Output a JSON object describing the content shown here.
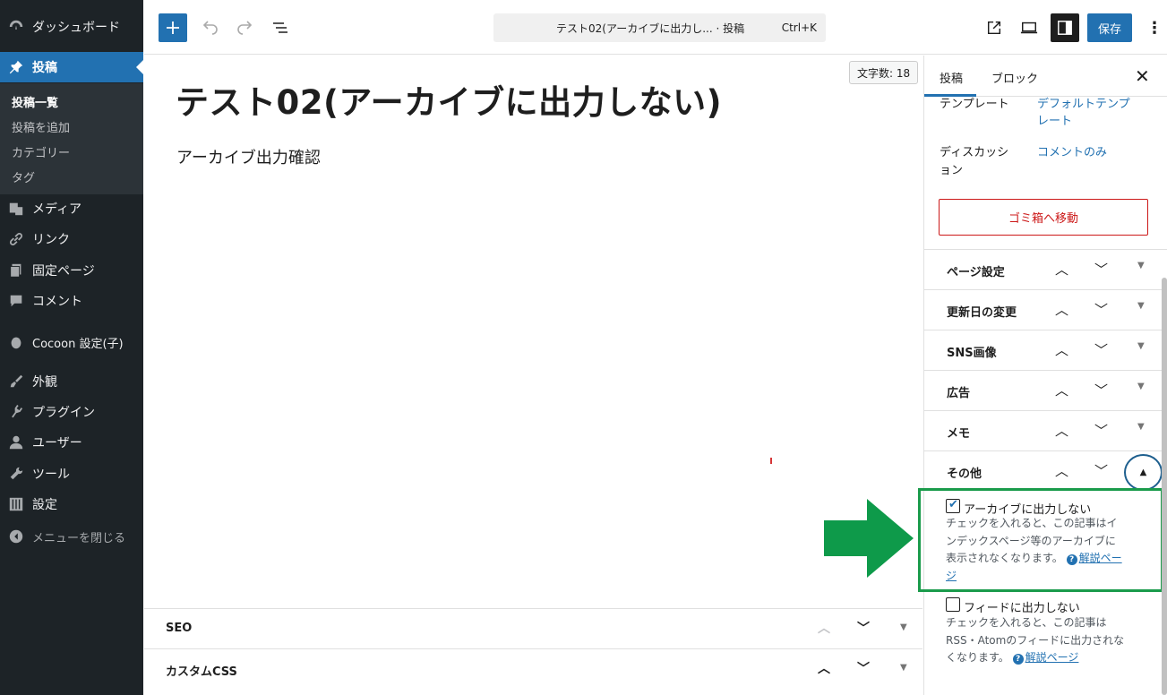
{
  "admin_menu": {
    "dashboard": "ダッシュボード",
    "posts": "投稿",
    "posts_sub": [
      "投稿一覧",
      "投稿を追加",
      "カテゴリー",
      "タグ"
    ],
    "media": "メディア",
    "links": "リンク",
    "pages": "固定ページ",
    "comments": "コメント",
    "cocoon": "Cocoon 設定(子)",
    "appearance": "外観",
    "plugins": "プラグイン",
    "users": "ユーザー",
    "tools": "ツール",
    "settings": "設定",
    "collapse": "メニューを閉じる"
  },
  "header": {
    "doc_title": "テスト02(アーカイブに出力し... · 投稿",
    "shortcut": "Ctrl+K",
    "save_label": "保存"
  },
  "canvas": {
    "title": "テスト02(アーカイブに出力しない)",
    "body": "アーカイブ出力確認",
    "word_count": "文字数: 18"
  },
  "metaboxes": [
    "SEO",
    "カスタムCSS"
  ],
  "settings": {
    "tab_post": "投稿",
    "tab_block": "ブロック",
    "template_label": "テンプレート",
    "template_value_1": "デフォルトテンプ",
    "template_value_2": "レート",
    "discussion_label_1": "ディスカッシ",
    "discussion_label_2": "ョン",
    "discussion_value": "コメントのみ",
    "trash": "ゴミ箱へ移動",
    "panels": [
      "ページ設定",
      "更新日の変更",
      "SNS画像",
      "広告",
      "メモ",
      "その他"
    ],
    "opt_archive": "アーカイブに出力しない",
    "opt_archive_desc_1": "チェックを入れると、この記事はイ",
    "opt_archive_desc_2": "ンデックスページ等のアーカイブに",
    "opt_archive_desc_3": "表示されなくなります。",
    "opt_archive_help_1": "解説ペー",
    "opt_archive_help_2": "ジ",
    "opt_feed": "フィードに出力しない",
    "opt_feed_desc_1": "チェックを入れると、この記事は",
    "opt_feed_desc_2": "RSS・Atomのフィードに出力されな",
    "opt_feed_desc_3": "くなります。",
    "opt_feed_help": "解説ページ",
    "help_glyph": "?"
  },
  "colors": {
    "accent": "#2271b1",
    "admin_bg": "#1d2327",
    "highlight": "#1a9b4b",
    "danger": "#cc1818"
  }
}
